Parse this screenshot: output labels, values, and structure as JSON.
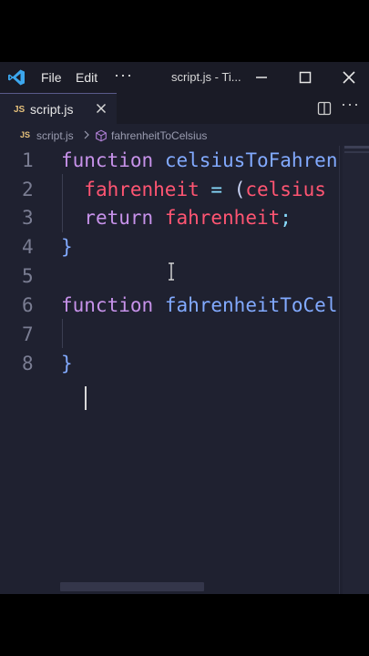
{
  "titlebar": {
    "menu": [
      "File",
      "Edit"
    ],
    "more": "···",
    "title": "script.js - Ti..."
  },
  "tab": {
    "badge": "JS",
    "label": "script.js",
    "more": "···"
  },
  "breadcrumb": {
    "badge": "JS",
    "file": "script.js",
    "symbol": "fahrenheitToCelsius"
  },
  "editor": {
    "line_numbers": [
      "1",
      "2",
      "3",
      "4",
      "5",
      "6",
      "7",
      "8"
    ],
    "code": {
      "l1_kw": "function",
      "l1_fn": "celsiusToFahrenheit",
      "l2_var": "fahrenheit",
      "l2_eq": "=",
      "l2_paren": "(",
      "l2_arg": "celsius",
      "l3_kw": "return",
      "l3_var": "fahrenheit",
      "l3_semi": ";",
      "l4_brace": "}",
      "l6_kw": "function",
      "l6_fn": "fahrenheitToCelsius",
      "l8_brace": "}"
    }
  },
  "colors": {
    "keyword": "#c792ea",
    "function": "#82aaff",
    "variable": "#ff5572",
    "background": "#1f2130"
  }
}
